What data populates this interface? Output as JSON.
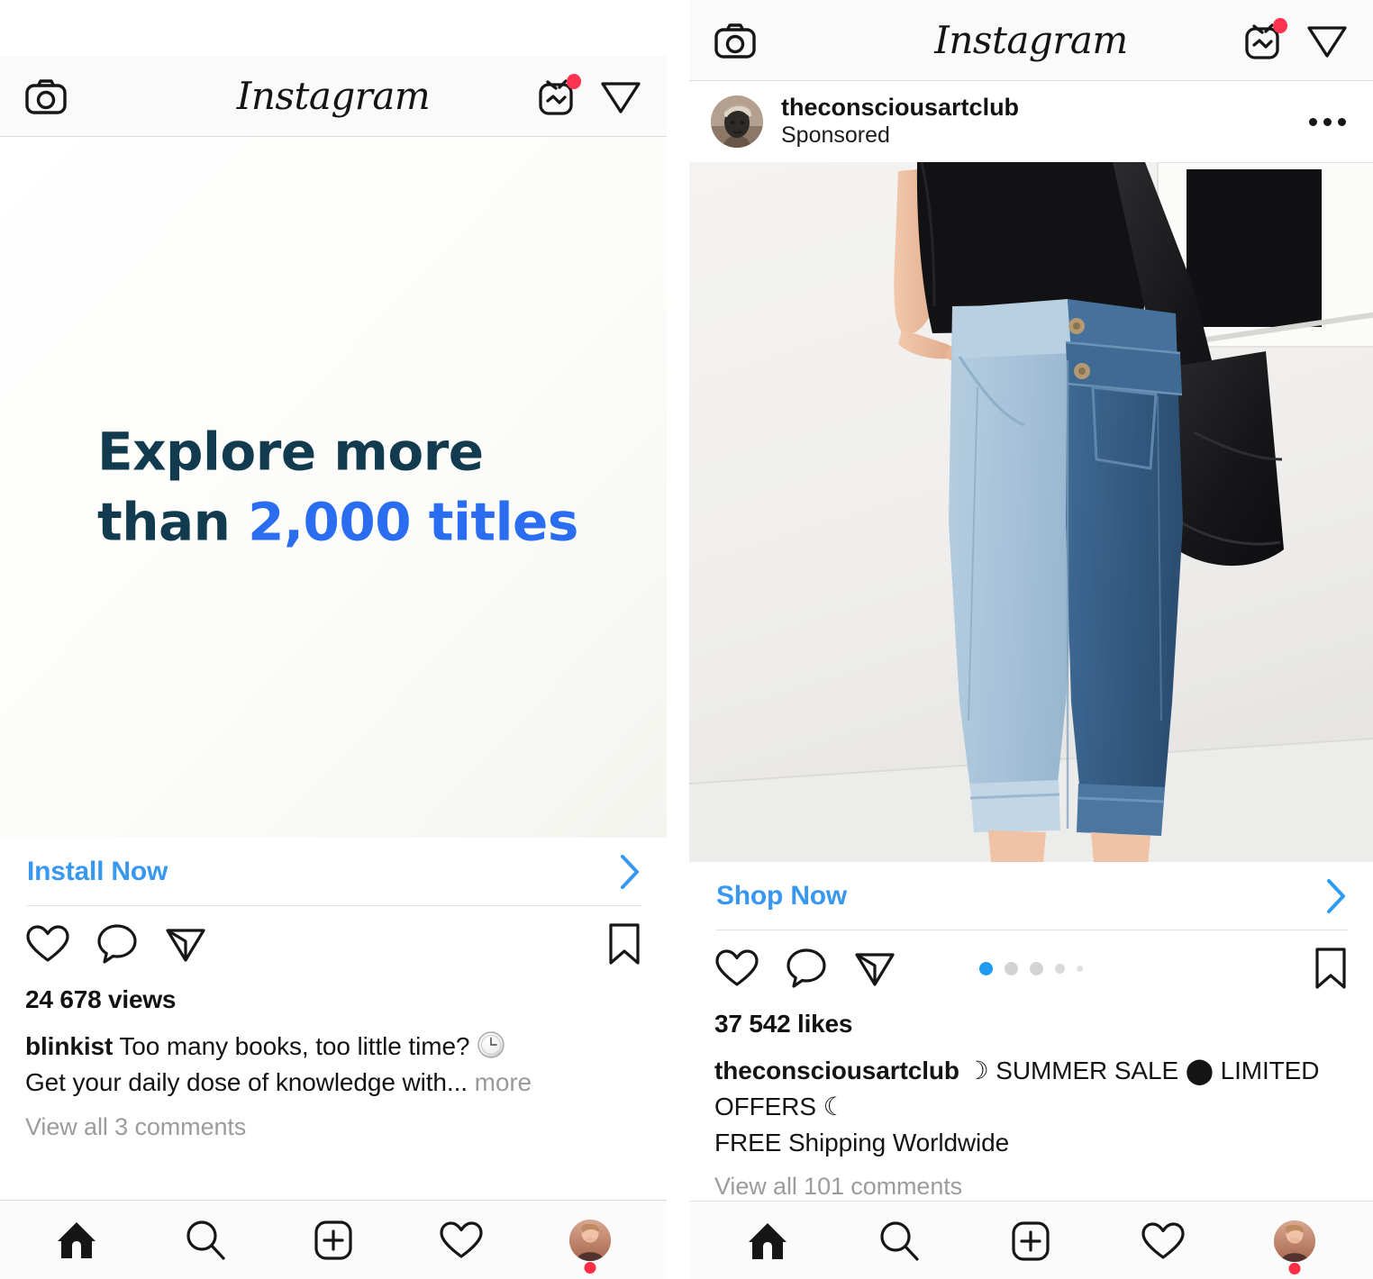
{
  "app": {
    "name": "Instagram",
    "logo_text": "Instagram",
    "icons": {
      "camera": "camera-icon",
      "igtv": "igtv-icon",
      "send": "send-icon",
      "home": "home-icon",
      "search": "search-icon",
      "add": "add-post-icon",
      "activity": "heart-icon",
      "profile": "profile-avatar"
    },
    "colors": {
      "link_blue": "#3897f0",
      "notification_red": "#ff3250",
      "active_dot_blue": "#1f9bf0",
      "inactive_dot_gray": "#d3d3d3",
      "text_primary": "#141414",
      "text_muted": "#9c9c9c",
      "header_bg": "#fafafa",
      "border": "#dcdcdc"
    }
  },
  "posts": [
    {
      "id": "blinkist-video-ad",
      "header_shows_author": false,
      "creative": {
        "type": "app-install-video-ad",
        "line1": "Explore more",
        "line2_prefix": "than ",
        "line2_highlight": "2,000 titles",
        "color_dark": "#123b50",
        "color_accent": "#2a6df0",
        "background": "#fbfbf9"
      },
      "cta": {
        "label": "Install Now",
        "chevron": "chevron-right-icon"
      },
      "actions": {
        "like": "heart-icon",
        "comment": "comment-icon",
        "share": "send-icon",
        "save": "bookmark-icon"
      },
      "stats": "24 678 views",
      "caption": {
        "username": "blinkist",
        "line1": "Too many books, too little time? ",
        "emoji1": "clock-emoji",
        "line2": "Get your daily dose of knowledge with...",
        "more_label": "more"
      },
      "comments_link": "View all 3 comments",
      "carousel": null
    },
    {
      "id": "theconsciousartclub-carousel-ad",
      "header_shows_author": true,
      "author": {
        "username": "theconsciousartclub",
        "subtitle": "Sponsored",
        "avatar": "statue-bust-avatar",
        "menu": "more-options-icon"
      },
      "creative": {
        "type": "photo",
        "description": "two-tone denim jeans outfit",
        "background": "#f3f2f0"
      },
      "cta": {
        "label": "Shop Now",
        "chevron": "chevron-right-icon"
      },
      "actions": {
        "like": "heart-icon",
        "comment": "comment-icon",
        "share": "send-icon",
        "save": "bookmark-icon"
      },
      "stats": "37 542 likes",
      "caption": {
        "username": "theconsciousartclub",
        "line1": " ☽ SUMMER SALE ⬤ LIMITED OFFERS ☾",
        "line2": "FREE Shipping Worldwide"
      },
      "comments_link": "View all 101 comments",
      "carousel": {
        "total": 5,
        "active_index": 0
      }
    }
  ]
}
